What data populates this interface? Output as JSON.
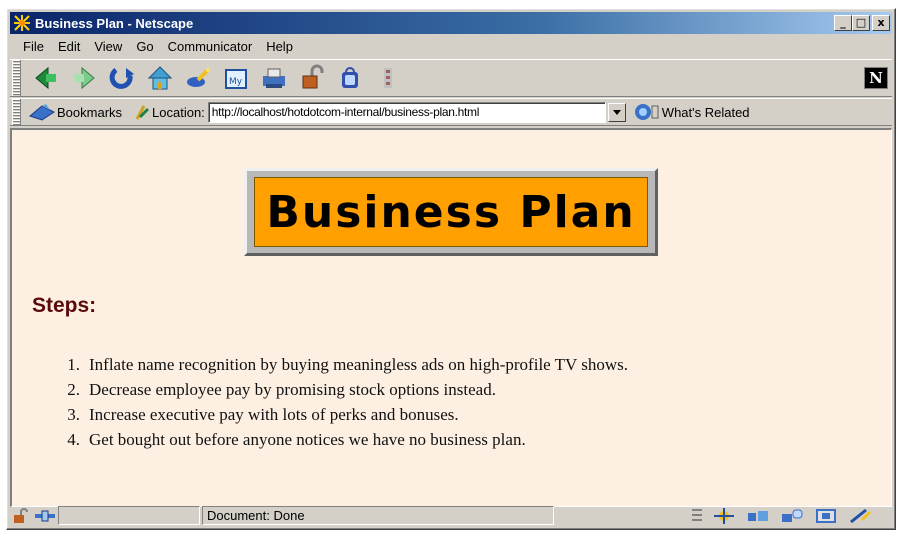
{
  "window": {
    "title": "Business Plan - Netscape",
    "controls": {
      "minimize": "_",
      "maximize": "□",
      "close": "x"
    }
  },
  "menu": [
    "File",
    "Edit",
    "View",
    "Go",
    "Communicator",
    "Help"
  ],
  "nav_toolbar": {
    "buttons": [
      "back-icon",
      "forward-icon",
      "reload-icon",
      "home-icon",
      "search-icon",
      "my-netscape-icon",
      "print-icon",
      "security-icon",
      "shop-icon",
      "stop-icon"
    ],
    "logo": "N"
  },
  "location_toolbar": {
    "bookmarks_label": "Bookmarks",
    "location_label": "Location:",
    "url": "http://localhost/hotdotcom-internal/business-plan.html",
    "whats_related_label": "What's Related"
  },
  "page": {
    "banner": "Business Plan",
    "heading": "Steps:",
    "steps": [
      "Inflate name recognition by buying meaningless ads on high-profile TV shows.",
      "Decrease employee pay by promising stock options instead.",
      "Increase executive pay with lots of perks and bonuses.",
      "Get bought out before anyone notices we have no business plan."
    ],
    "step_numbers": [
      "1.",
      "2.",
      "3.",
      "4."
    ]
  },
  "status": {
    "text": "Document: Done"
  },
  "colors": {
    "title_gradient_start": "#0a246a",
    "content_bg": "#fdf0e3",
    "banner_bg": "#ffa000",
    "heading": "#5a0a0a"
  }
}
